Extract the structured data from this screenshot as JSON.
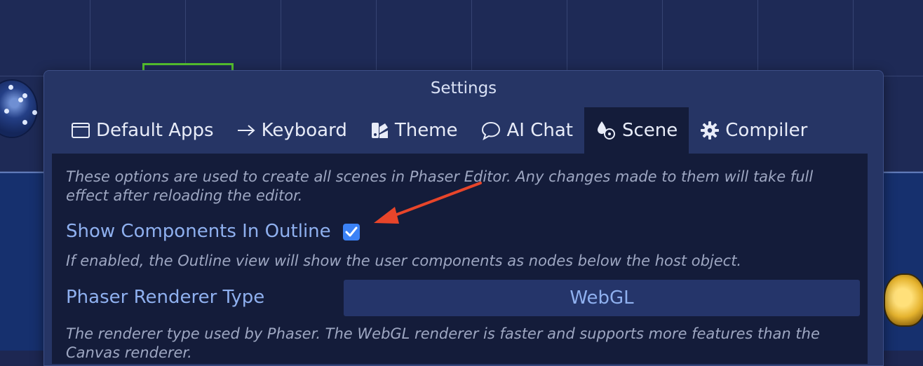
{
  "dialog": {
    "title": "Settings",
    "tabs": [
      {
        "label": "Default Apps",
        "icon": "window-icon"
      },
      {
        "label": "Keyboard",
        "icon": "arrow-right-icon"
      },
      {
        "label": "Theme",
        "icon": "palette-icon"
      },
      {
        "label": "AI Chat",
        "icon": "chat-bubble-icon"
      },
      {
        "label": "Scene",
        "icon": "scene-shapes-icon",
        "active": true
      },
      {
        "label": "Compiler",
        "icon": "gear-icon"
      }
    ]
  },
  "scene_settings": {
    "intro": "These options are used to create all scenes in Phaser Editor. Any changes made to them will take full effect after reloading the editor.",
    "show_components": {
      "label": "Show Components In Outline",
      "checked": true,
      "help": "If enabled, the Outline view will show the user components as nodes below the host object."
    },
    "renderer": {
      "label": "Phaser Renderer Type",
      "value": "WebGL",
      "help": "The renderer type used by Phaser. The WebGL renderer is faster and supports more features than the Canvas renderer."
    }
  },
  "colors": {
    "annotation_arrow": "#e8452a",
    "accent_label": "#8fb0ef",
    "checkbox": "#3b82f6"
  }
}
